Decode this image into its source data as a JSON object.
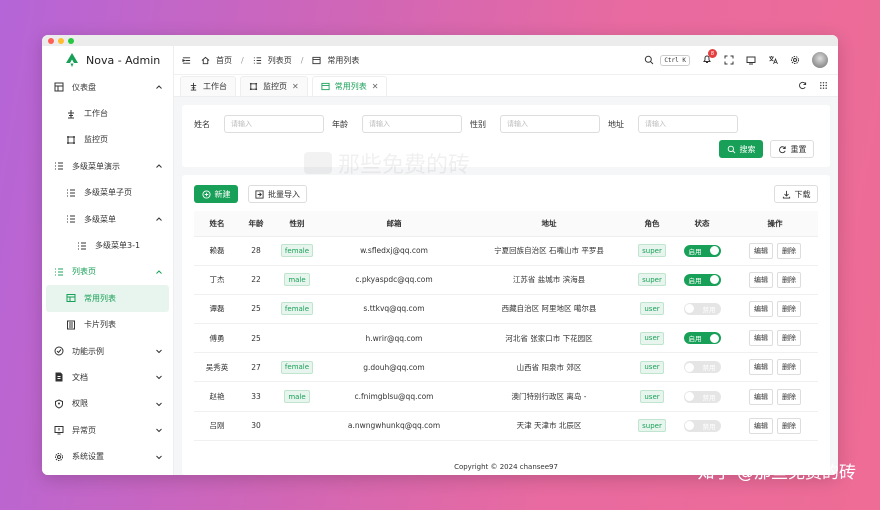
{
  "app": {
    "title": "Nova - Admin"
  },
  "sidebar": {
    "items": [
      {
        "label": "仪表盘",
        "level": 0,
        "icon": "dashboard-icon",
        "chevron": "up",
        "state": ""
      },
      {
        "label": "工作台",
        "level": 1,
        "icon": "workbench-icon",
        "chevron": "",
        "state": ""
      },
      {
        "label": "监控页",
        "level": 1,
        "icon": "monitor-icon",
        "chevron": "",
        "state": ""
      },
      {
        "label": "多级菜单演示",
        "level": 0,
        "icon": "list-icon",
        "chevron": "up",
        "state": ""
      },
      {
        "label": "多级菜单子页",
        "level": 1,
        "icon": "list-icon",
        "chevron": "",
        "state": ""
      },
      {
        "label": "多级菜单",
        "level": 1,
        "icon": "list-icon",
        "chevron": "up",
        "state": ""
      },
      {
        "label": "多级菜单3-1",
        "level": 2,
        "icon": "list-icon",
        "chevron": "",
        "state": ""
      },
      {
        "label": "列表页",
        "level": 0,
        "icon": "list-icon",
        "chevron": "up",
        "state": "group-active"
      },
      {
        "label": "常用列表",
        "level": 1,
        "icon": "table-icon",
        "chevron": "",
        "state": "active"
      },
      {
        "label": "卡片列表",
        "level": 1,
        "icon": "card-icon",
        "chevron": "",
        "state": ""
      },
      {
        "label": "功能示例",
        "level": 0,
        "icon": "function-icon",
        "chevron": "down",
        "state": ""
      },
      {
        "label": "文档",
        "level": 0,
        "icon": "document-icon",
        "chevron": "down",
        "state": ""
      },
      {
        "label": "权限",
        "level": 0,
        "icon": "shield-icon",
        "chevron": "down",
        "state": ""
      },
      {
        "label": "异常页",
        "level": 0,
        "icon": "error-page-icon",
        "chevron": "down",
        "state": ""
      },
      {
        "label": "系统设置",
        "level": 0,
        "icon": "gear-icon",
        "chevron": "down",
        "state": ""
      }
    ]
  },
  "header": {
    "breadcrumb": [
      "首页",
      "列表页",
      "常用列表"
    ],
    "sep": "/",
    "search_shortcut": "Ctrl K",
    "notification_count": "8"
  },
  "tabs": [
    {
      "label": "工作台",
      "closable": false,
      "active": false
    },
    {
      "label": "监控页",
      "closable": true,
      "active": false
    },
    {
      "label": "常用列表",
      "closable": true,
      "active": true
    }
  ],
  "search_form": {
    "fields": [
      {
        "label": "姓名",
        "placeholder": "请输入"
      },
      {
        "label": "年龄",
        "placeholder": "请输入"
      },
      {
        "label": "性别",
        "placeholder": "请输入"
      },
      {
        "label": "地址",
        "placeholder": "请输入"
      }
    ],
    "search_label": "搜索",
    "reset_label": "重置"
  },
  "toolbar": {
    "new_label": "新建",
    "import_label": "批量导入",
    "download_label": "下载"
  },
  "table": {
    "columns": [
      "姓名",
      "年龄",
      "性别",
      "邮箱",
      "地址",
      "角色",
      "状态",
      "操作"
    ],
    "edit_label": "编辑",
    "delete_label": "删除",
    "on_label": "启用",
    "off_label": "禁用",
    "rows": [
      {
        "name": "赖磊",
        "age": "28",
        "gender": "female",
        "email": "w.sfledxj@qq.com",
        "address": "宁夏回族自治区 石嘴山市 平罗县",
        "role": "super",
        "status": "on"
      },
      {
        "name": "丁杰",
        "age": "22",
        "gender": "male",
        "email": "c.pkyaspdc@qq.com",
        "address": "江苏省 盐城市 滨海县",
        "role": "super",
        "status": "on"
      },
      {
        "name": "谭磊",
        "age": "25",
        "gender": "female",
        "email": "s.ttkvq@qq.com",
        "address": "西藏自治区 阿里地区 噶尔县",
        "role": "user",
        "status": "off"
      },
      {
        "name": "傅勇",
        "age": "25",
        "gender": "",
        "email": "h.wrir@qq.com",
        "address": "河北省 张家口市 下花园区",
        "role": "user",
        "status": "on"
      },
      {
        "name": "吴秀英",
        "age": "27",
        "gender": "female",
        "email": "g.douh@qq.com",
        "address": "山西省 阳泉市 郊区",
        "role": "user",
        "status": "off"
      },
      {
        "name": "赵艳",
        "age": "33",
        "gender": "male",
        "email": "c.fnimgblsu@qq.com",
        "address": "澳门特别行政区 离岛 -",
        "role": "user",
        "status": "off"
      },
      {
        "name": "吕刚",
        "age": "30",
        "gender": "",
        "email": "a.nwngwhunkq@qq.com",
        "address": "天津 天津市 北辰区",
        "role": "super",
        "status": "off"
      }
    ]
  },
  "footer": {
    "copyright": "Copyright © 2024 chansee97"
  },
  "overlay": {
    "watermark": "那些免费的砖",
    "credit": "知乎 @那些免费的砖"
  },
  "colors": {
    "primary": "#18a058",
    "background_left": "#b565d8",
    "background_right": "#ee6c95"
  }
}
